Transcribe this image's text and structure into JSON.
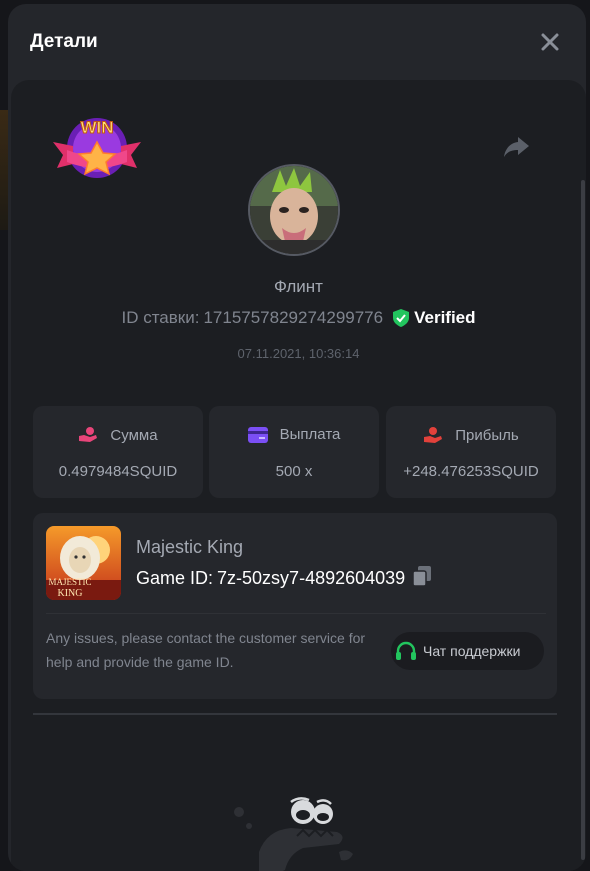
{
  "modal": {
    "title": "Детали"
  },
  "player": {
    "name": "Флинт"
  },
  "bet": {
    "id_label": "ID ставки:",
    "id_value": "1715757829274299776",
    "verified_label": "Verified",
    "datetime": "07.11.2021, 10:36:14"
  },
  "badge": {
    "text": "WIN"
  },
  "stats": [
    {
      "label": "Сумма",
      "value": "0.4979484SQUID",
      "icon": "coins-hand-icon",
      "color": "#e8457a"
    },
    {
      "label": "Выплата",
      "value": "500 x",
      "icon": "card-icon",
      "color": "#7b4ff5"
    },
    {
      "label": "Прибыль",
      "value": "+248.476253SQUID",
      "icon": "profit-hand-icon",
      "color": "#e2413b"
    }
  ],
  "game": {
    "name": "Majestic King",
    "id_label": "Game ID:",
    "id_value": "7z-50zsy7-4892604039",
    "thumb_title": "MAJESTIC",
    "thumb_subtitle": "KING"
  },
  "support": {
    "notice": "Any issues, please contact the customer service for help and provide the game ID.",
    "button_label": "Чат поддержки"
  },
  "colors": {
    "verified": "#22c55e",
    "support_icon": "#22c55e"
  }
}
